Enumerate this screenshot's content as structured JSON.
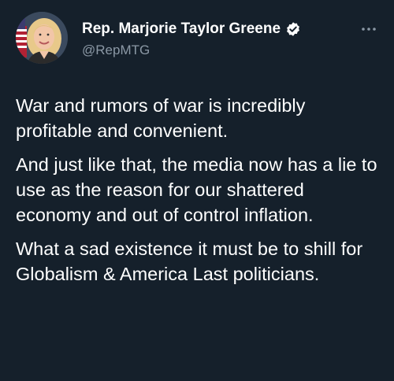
{
  "author": {
    "display_name": "Rep. Marjorie Taylor Greene",
    "handle": "@RepMTG",
    "verified": true,
    "avatar_icon": "profile-photo"
  },
  "tweet": {
    "paragraphs": [
      "War and rumors of war is incredibly profitable and convenient.",
      "And just like that, the media now has a lie to use as the reason for our shattered economy and out of control inflation.",
      "What a sad existence it must be to shill for Globalism & America Last politicians."
    ]
  },
  "icons": {
    "more": "more-horizontal-icon",
    "verified": "verified-badge-icon"
  },
  "colors": {
    "background": "#15202b",
    "text": "#ffffff",
    "secondary_text": "#8b98a5"
  }
}
